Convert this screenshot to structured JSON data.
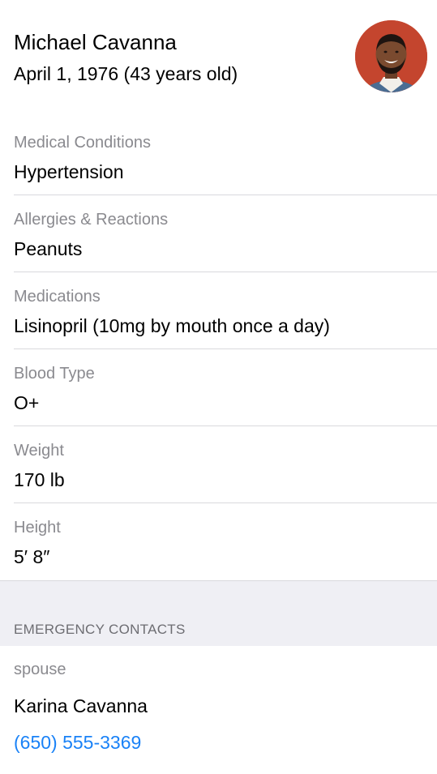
{
  "profile": {
    "name": "Michael Cavanna",
    "birth": "April 1, 1976 (43 years old)",
    "avatar_icon": "person-photo"
  },
  "fields": [
    {
      "label": "Medical Conditions",
      "value": "Hypertension"
    },
    {
      "label": "Allergies & Reactions",
      "value": "Peanuts"
    },
    {
      "label": "Medications",
      "value": "Lisinopril (10mg by mouth once a day)"
    },
    {
      "label": "Blood Type",
      "value": "O+"
    },
    {
      "label": "Weight",
      "value": "170 lb"
    },
    {
      "label": "Height",
      "value": "5′ 8″"
    }
  ],
  "emergency": {
    "section_title": "EMERGENCY CONTACTS",
    "contacts": [
      {
        "relation": "spouse",
        "name": "Karina Cavanna",
        "phone": "(650) 555-3369"
      }
    ]
  },
  "colors": {
    "link": "#1a82f7",
    "secondary_text": "#8a8a8f",
    "section_bg": "#efeff4",
    "avatar_bg": "#c4452e"
  }
}
